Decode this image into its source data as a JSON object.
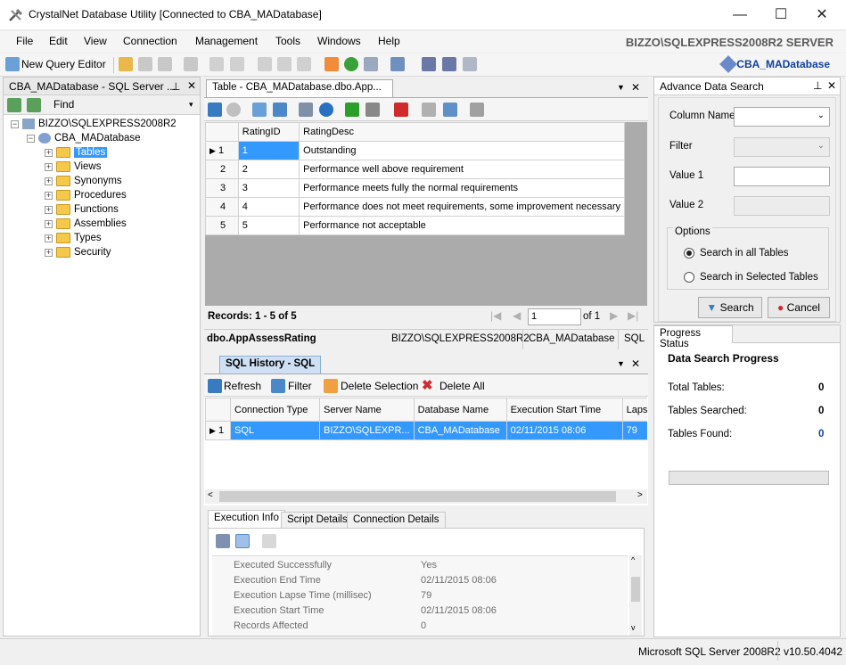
{
  "window": {
    "title": "CrystalNet Database Utility [Connected to CBA_MADatabase]",
    "minimize": "—",
    "maximize": "☐",
    "close": "✕"
  },
  "menu": [
    "File",
    "Edit",
    "View",
    "Connection",
    "Management",
    "Tools",
    "Windows",
    "Help"
  ],
  "server_title": "BIZZO\\SQLEXPRESS2008R2 SERVER",
  "toolbar": {
    "new_query": "New Query Editor",
    "connected_db": "CBA_MADatabase"
  },
  "explorer": {
    "title": "CBA_MADatabase - SQL Server ...",
    "find": "Find",
    "server": "BIZZO\\SQLEXPRESS2008R2",
    "database": "CBA_MADatabase",
    "nodes": [
      "Tables",
      "Views",
      "Synonyms",
      "Procedures",
      "Functions",
      "Assemblies",
      "Types",
      "Security"
    ]
  },
  "table_doc": {
    "tab": "Table - CBA_MADatabase.dbo.App...",
    "columns": [
      "RatingID",
      "RatingDesc"
    ],
    "rows": [
      {
        "n": "1",
        "id": "1",
        "desc": "Outstanding"
      },
      {
        "n": "2",
        "id": "2",
        "desc": "Performance well above requirement"
      },
      {
        "n": "3",
        "id": "3",
        "desc": "Performance meets fully the normal requirements"
      },
      {
        "n": "4",
        "id": "4",
        "desc": "Performance does not meet requirements, some improvement necessary"
      },
      {
        "n": "5",
        "id": "5",
        "desc": "Performance not acceptable"
      }
    ],
    "records": "Records: 1 - 5 of 5",
    "page": "1",
    "of": "of 1",
    "status_table": "dbo.AppAssessRating",
    "status_server": "BIZZO\\SQLEXPRESS2008R2",
    "status_db": "CBA_MADatabase",
    "status_type": "SQL"
  },
  "history": {
    "tab": "SQL History - SQL",
    "refresh": "Refresh",
    "filter": "Filter",
    "delete_selection": "Delete Selection",
    "delete_all": "Delete All",
    "columns": [
      "Connection Type",
      "Server Name",
      "Database Name",
      "Execution Start Time",
      "Lapse"
    ],
    "row": {
      "n": "1",
      "type": "SQL",
      "server": "BIZZO\\SQLEXPR...",
      "db": "CBA_MADatabase",
      "start": "02/11/2015 08:06",
      "lapse": "79"
    }
  },
  "exec_tabs": [
    "Execution Info",
    "Script Details",
    "Connection Details"
  ],
  "exec_props": [
    {
      "k": "Executed Successfully",
      "v": "Yes"
    },
    {
      "k": "Execution End Time",
      "v": "02/11/2015 08:06"
    },
    {
      "k": "Execution Lapse Time (millisec)",
      "v": "79"
    },
    {
      "k": "Execution Start Time",
      "v": "02/11/2015 08:06"
    },
    {
      "k": "Records Affected",
      "v": "0"
    }
  ],
  "search": {
    "title": "Advance Data Search",
    "column_name": "Column Name",
    "filter": "Filter",
    "value1": "Value 1",
    "value2": "Value 2",
    "options": "Options",
    "opt_all": "Search in all Tables",
    "opt_selected": "Search in Selected Tables",
    "search_btn": "Search",
    "cancel_btn": "Cancel"
  },
  "progress": {
    "tab": "Progress Status",
    "title": "Data Search Progress",
    "total_label": "Total Tables:",
    "total": "0",
    "searched_label": "Tables Searched:",
    "searched": "0",
    "found_label": "Tables Found:",
    "found": "0"
  },
  "statusbar": {
    "server": "Microsoft SQL Server 2008R2",
    "version": "v10.50.4042"
  },
  "colors": {
    "selected": "#3399ff",
    "accent": "#1040a0"
  }
}
